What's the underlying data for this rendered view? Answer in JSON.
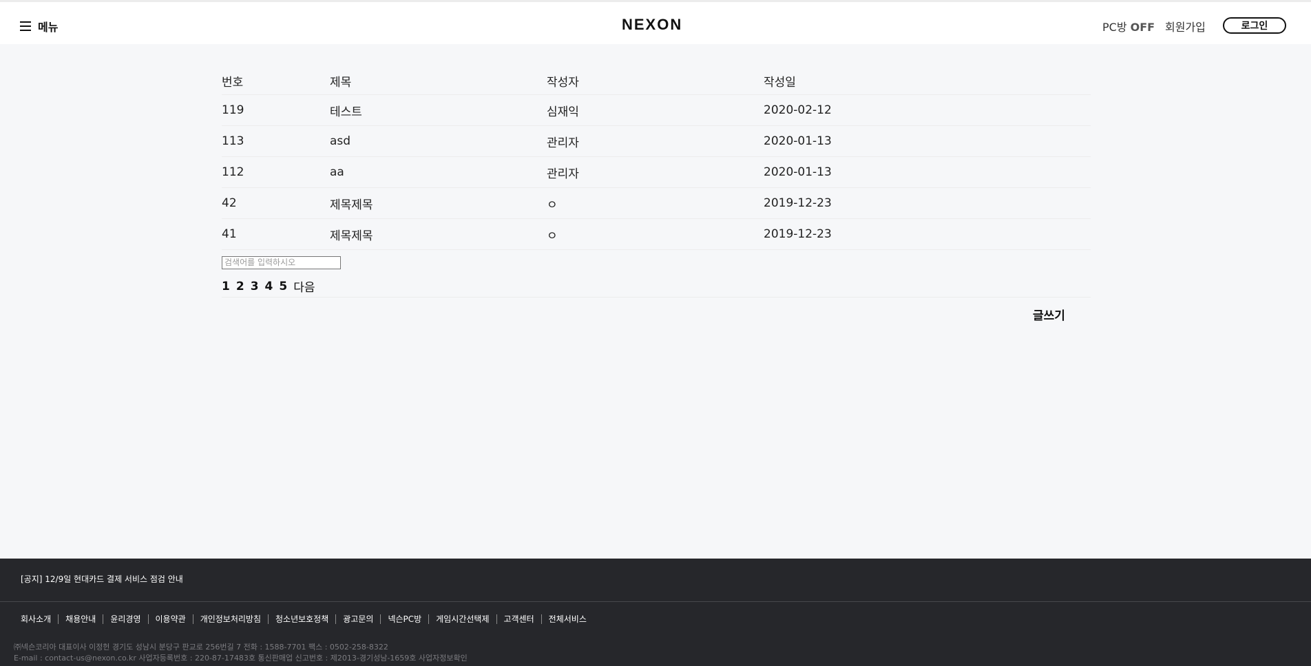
{
  "header": {
    "menu_label": "메뉴",
    "logo": "NEXON",
    "pcbang_label": "PC방",
    "pcbang_status": "OFF",
    "signup_label": "회원가입",
    "login_label": "로그인"
  },
  "board": {
    "columns": [
      "번호",
      "제목",
      "작성자",
      "작성일"
    ],
    "rows": [
      {
        "no": "119",
        "title": "테스트",
        "writer": "심재익",
        "date": "2020-02-12"
      },
      {
        "no": "113",
        "title": "asd",
        "writer": "관리자",
        "date": "2020-01-13"
      },
      {
        "no": "112",
        "title": "aa",
        "writer": "관리자",
        "date": "2020-01-13"
      },
      {
        "no": "42",
        "title": "제목제목",
        "writer": "ㅇ",
        "date": "2019-12-23"
      },
      {
        "no": "41",
        "title": "제목제목",
        "writer": "ㅇ",
        "date": "2019-12-23"
      }
    ],
    "search_placeholder": "검색어를 입력하시오",
    "pages": [
      "1",
      "2",
      "3",
      "4",
      "5"
    ],
    "next_label": "다음",
    "write_label": "글쓰기"
  },
  "footer": {
    "notice": "[공지] 12/9일 현대카드 결제 서비스 점검 안내",
    "links": [
      "회사소개",
      "채용안내",
      "윤리경영",
      "이용약관",
      "개인정보처리방침",
      "청소년보호정책",
      "광고문의",
      "넥슨PC방",
      "게임시간선택제",
      "고객센터",
      "전체서비스"
    ],
    "company_line1": "㈜넥슨코리아 대표이사 이정헌 경기도 성남시 분당구 판교로 256번길 7 전화 : 1588-7701 팩스 : 0502-258-8322",
    "company_line2": "E-mail : contact-us@nexon.co.kr 사업자등록번호 : 220-87-17483호 통신판매업 신고번호 : 제2013-경기성남-1659호 사업자정보확인"
  }
}
